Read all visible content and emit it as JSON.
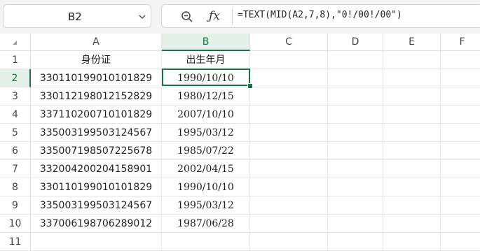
{
  "name_box": {
    "value": "B2"
  },
  "formula_bar": {
    "formula": "=TEXT(MID(A2,7,8),\"0!/00!/00\")"
  },
  "columns": [
    "A",
    "B",
    "C",
    "D",
    "E",
    "F"
  ],
  "rows": [
    "1",
    "2",
    "3",
    "4",
    "5",
    "6",
    "7",
    "8",
    "9",
    "10",
    "11"
  ],
  "cells": [
    [
      "身份证",
      "出生年月"
    ],
    [
      "330110199010101829",
      "1990/10/10"
    ],
    [
      "330112198012152829",
      "1980/12/15"
    ],
    [
      "337110200710101829",
      "2007/10/10"
    ],
    [
      "335003199503124567",
      "1995/03/12"
    ],
    [
      "335007198507225678",
      "1985/07/22"
    ],
    [
      "332004200204158901",
      "2002/04/15"
    ],
    [
      "330110199010101829",
      "1990/10/10"
    ],
    [
      "335003199503124567",
      "1995/03/12"
    ],
    [
      "337006198706289012",
      "1987/06/28"
    ],
    [
      "",
      ""
    ]
  ],
  "active_cell": "B2",
  "colors": {
    "accent": "#1e7145",
    "header_selected_bg": "#e3f1e8"
  }
}
